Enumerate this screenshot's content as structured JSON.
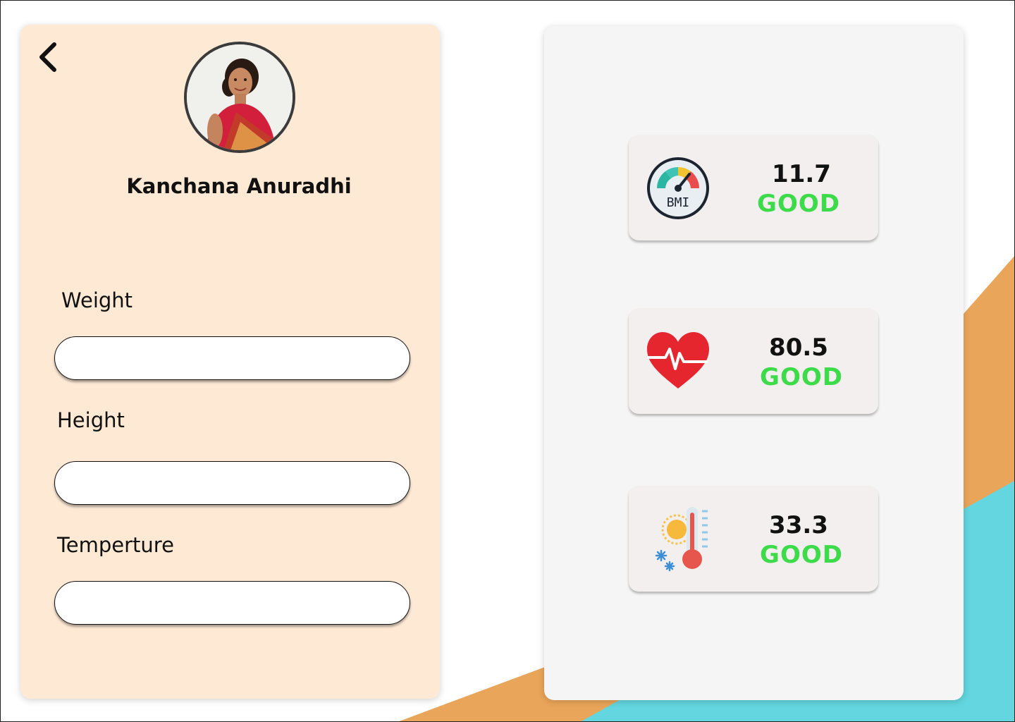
{
  "profile": {
    "name": "Kanchana Anuradhi",
    "avatar_icon": "profile-photo",
    "back_icon": "chevron-left-icon"
  },
  "form": {
    "weight_label": "Weight",
    "weight_value": "",
    "height_label": "Height",
    "height_value": "",
    "temperature_label": "Temperture",
    "temperature_value": ""
  },
  "metrics": [
    {
      "icon": "bmi-gauge-icon",
      "value": "11.7",
      "status": "GOOD"
    },
    {
      "icon": "heart-rate-icon",
      "value": "80.5",
      "status": "GOOD"
    },
    {
      "icon": "thermometer-icon",
      "value": "33.3",
      "status": "GOOD"
    }
  ],
  "colors": {
    "left_panel": "#fee9d5",
    "right_panel": "#f5f5f5",
    "status_good": "#3ddb4a",
    "accent_orange": "#e9a55a",
    "accent_teal": "#63d6df"
  }
}
